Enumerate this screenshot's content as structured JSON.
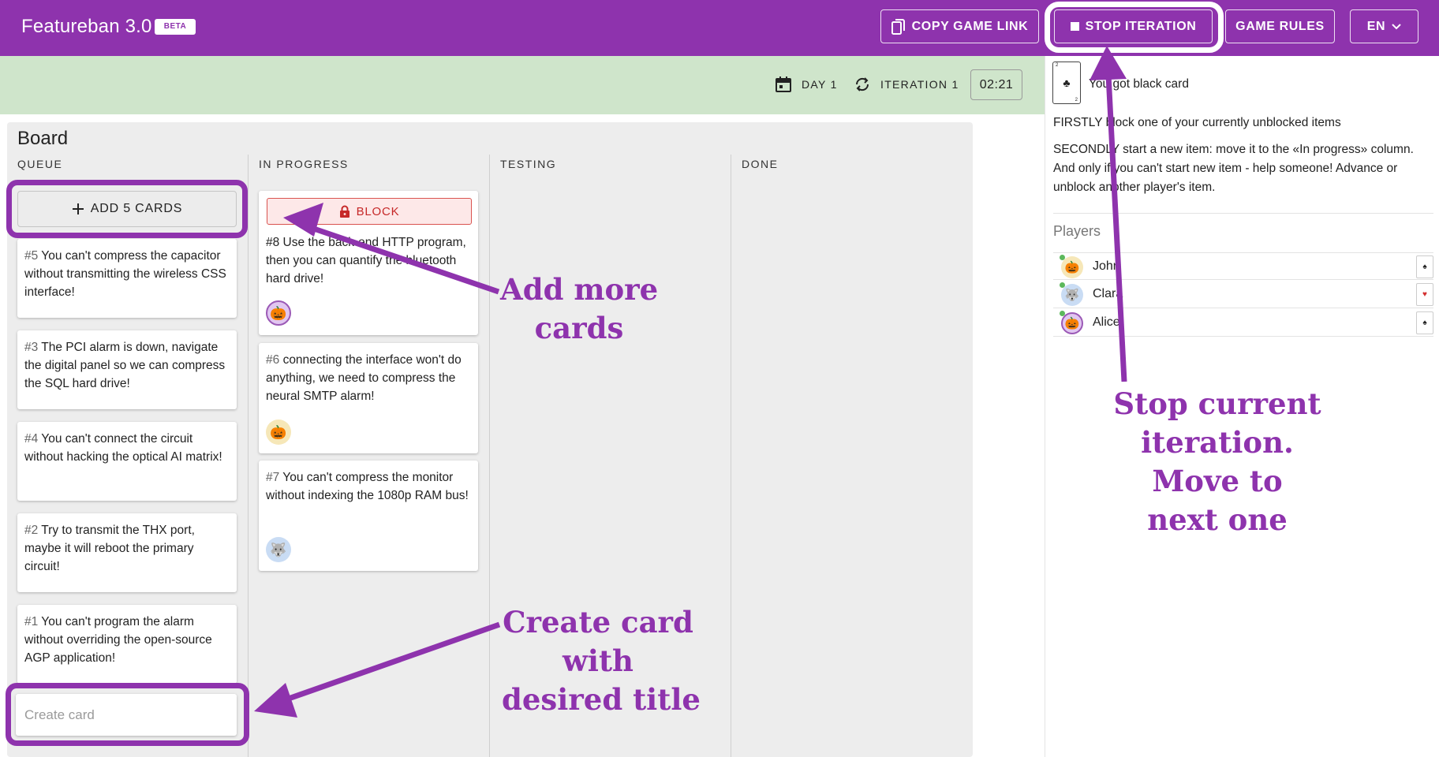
{
  "header": {
    "app_title": "Featureban 3.0",
    "badge": "BETA",
    "copy_link_label": "COPY GAME LINK",
    "stop_iteration_label": "STOP ITERATION",
    "game_rules_label": "GAME RULES",
    "language": "EN"
  },
  "status": {
    "day_label": "DAY 1",
    "iteration_label": "ITERATION 1",
    "timer": "02:21"
  },
  "board": {
    "title": "Board",
    "columns": [
      "QUEUE",
      "IN PROGRESS",
      "TESTING",
      "DONE"
    ],
    "add_cards_label": "ADD 5 CARDS",
    "block_label": "BLOCK",
    "create_placeholder": "Create card",
    "queue": [
      {
        "num": "#5",
        "text": "You can't compress the capacitor without transmitting the wireless CSS interface!"
      },
      {
        "num": "#3",
        "text": "The PCI alarm is down, navigate the digital panel so we can compress the SQL hard drive!"
      },
      {
        "num": "#4",
        "text": "You can't connect the circuit without hacking the optical AI matrix!"
      },
      {
        "num": "#2",
        "text": "Try to transmit the THX port, maybe it will reboot the primary circuit!"
      },
      {
        "num": "#1",
        "text": "You can't program the alarm without overriding the open-source AGP application!"
      }
    ],
    "in_progress": [
      {
        "text": "#8 Use the back-end HTTP program, then you can quantify the bluetooth hard drive!",
        "avatar": "pumpkin"
      },
      {
        "num": "#6",
        "text": "connecting the interface won't do anything, we need to compress the neural SMTP alarm!",
        "avatar": "pumpkin"
      },
      {
        "num": "#7",
        "text": "You can't compress the monitor without indexing the 1080p RAM bus!",
        "avatar": "wolf"
      }
    ]
  },
  "panel": {
    "card_message": "You got black card",
    "card_suit": "♣",
    "firstly": "FIRSTLY block one of your currently unblocked items",
    "secondly": "SECONDLY start a new item: move it to the «In progress» column. And only if you can't start new item - help someone! Advance or unblock another player's item.",
    "players_title": "Players",
    "players": [
      {
        "name": "John",
        "avatar": "pumpkin",
        "suit": "♠"
      },
      {
        "name": "Clara",
        "avatar": "wolf",
        "suit": "♥"
      },
      {
        "name": "Alice",
        "avatar": "pumpkin",
        "suit": "♠"
      }
    ]
  },
  "annotations": {
    "add_more": [
      "Add more",
      "cards"
    ],
    "stop_current": [
      "Stop current",
      "iteration.",
      "Move to",
      "next one"
    ],
    "create_card": [
      "Create card",
      "with",
      "desired title"
    ]
  },
  "colors": {
    "brand": "#8e33ad",
    "status_bar": "#cfe5cb",
    "block_red": "#c62828"
  }
}
